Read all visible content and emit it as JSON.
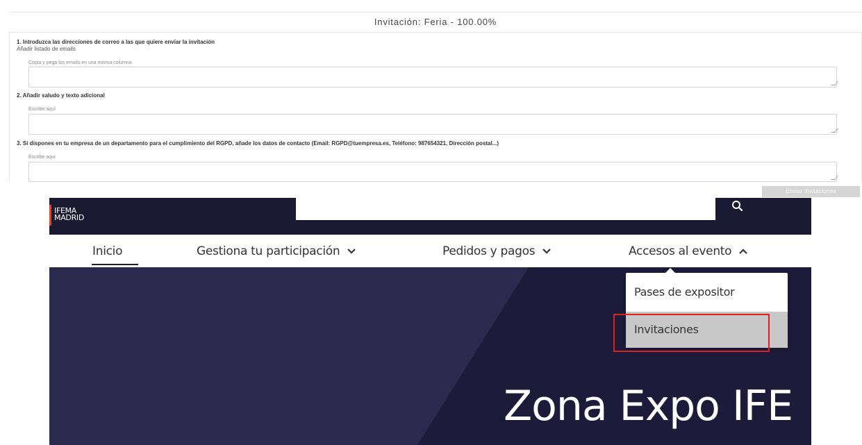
{
  "form": {
    "title": "Invitación: Feria - 100.00%",
    "step1_title": "1. Introduzca las direcciones de correo a las que quiere enviar la invitación",
    "step1_link": "Añadir listado de emails",
    "step1_field_label": "Copia y pega los emails en una misma columna",
    "step2_title": "2. Añadir saludo y texto adicional",
    "step2_field_label": "Escribe aquí",
    "step3_title": "3. Si dispones en tu empresa de un departamento para el cumplimiento del RGPD, añade los datos de contacto (Email: RGPD@tuempresa.es, Teléfono: 987654321, Dirección postal...)",
    "step3_field_label": "Escribe aquí",
    "send_button": "Enviar invitaciones"
  },
  "site": {
    "logo_line1": "IFEMA",
    "logo_line2": "MADRID",
    "nav": [
      {
        "label": "Inicio"
      },
      {
        "label": "Gestiona tu participación",
        "icon": "chevron-down-icon"
      },
      {
        "label": "Pedidos y pagos",
        "icon": "chevron-down-icon"
      },
      {
        "label": "Accesos al evento",
        "icon": "chevron-up-icon"
      }
    ],
    "dropdown_items": [
      "Pases de expositor",
      "Invitaciones"
    ],
    "hero_title": "Zona Expo IFE",
    "colors": {
      "navy": "#1a1a33",
      "brand_red": "#e5402e",
      "highlight": "#e02020"
    }
  }
}
